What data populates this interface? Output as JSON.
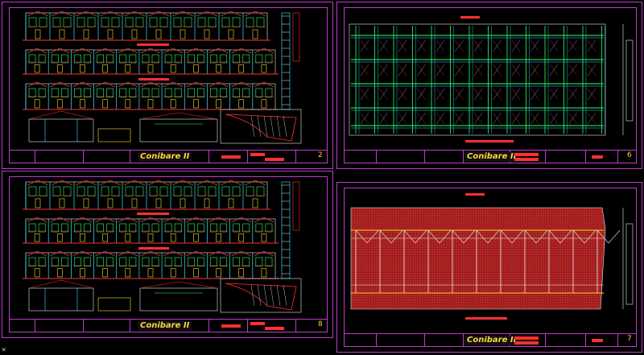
{
  "sheets": [
    {
      "id": "s1",
      "title_label": "Conibare II",
      "sheet_no": "2"
    },
    {
      "id": "s2",
      "title_label": "Conibare II",
      "sheet_no": "6"
    },
    {
      "id": "s3",
      "title_label": "Conibare II",
      "sheet_no": "8"
    },
    {
      "id": "s4",
      "title_label": "Conibare II",
      "sheet_no": "7"
    }
  ],
  "status": {
    "cursor_glyph": "×"
  },
  "colors": {
    "frame": "#c03ccc",
    "line_red": "#ff3030",
    "line_green": "#30ff6a",
    "line_cyan": "#34e6ff",
    "line_white": "#e8e8e8",
    "line_yellow": "#ffe030",
    "hatch": "#9a1b1b"
  }
}
